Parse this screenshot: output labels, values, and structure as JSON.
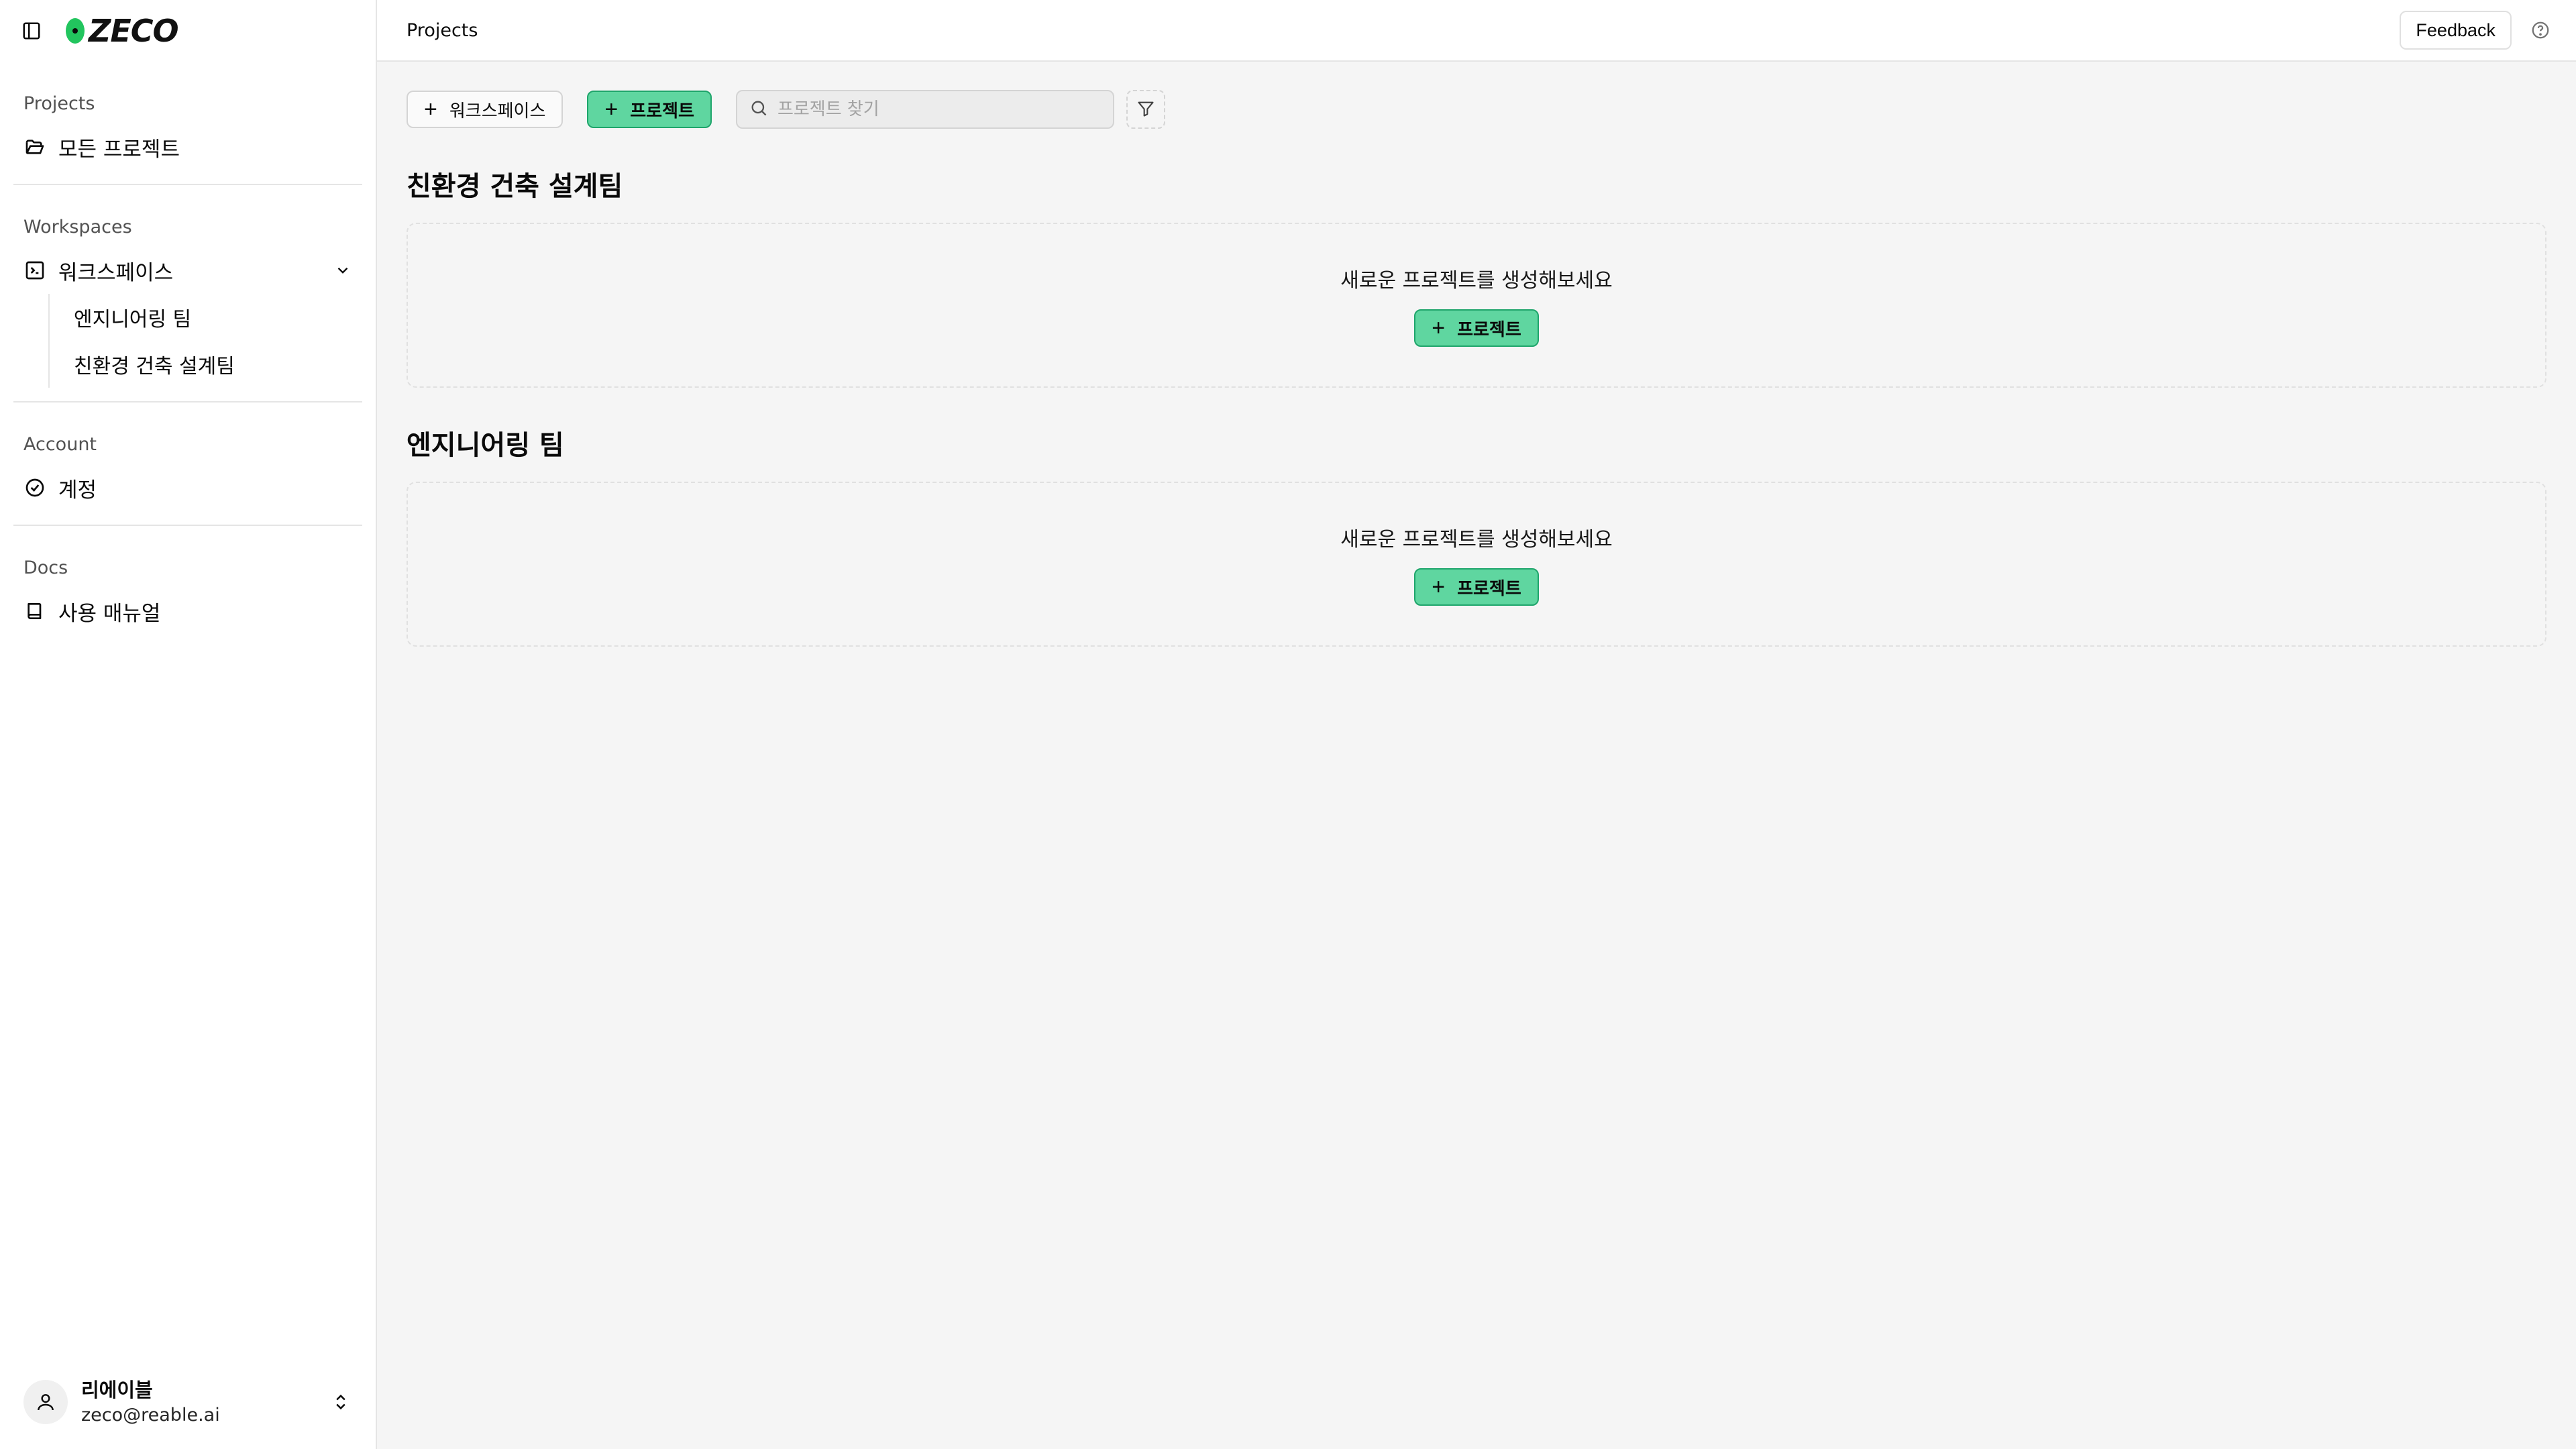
{
  "app": {
    "logo_text": "ZECO",
    "brand_color": "#22c55e"
  },
  "sidebar": {
    "groups": [
      {
        "label": "Projects",
        "items": [
          {
            "label": "모든 프로젝트",
            "icon": "folder-open-icon"
          }
        ]
      },
      {
        "label": "Workspaces",
        "items": [
          {
            "label": "워크스페이스",
            "icon": "workspace-icon"
          }
        ],
        "sub_items": [
          {
            "label": "엔지니어링 팀"
          },
          {
            "label": "친환경 건축 설계팀"
          }
        ]
      },
      {
        "label": "Account",
        "items": [
          {
            "label": "계정",
            "icon": "check-circle-icon"
          }
        ]
      },
      {
        "label": "Docs",
        "items": [
          {
            "label": "사용 매뉴얼",
            "icon": "book-icon"
          }
        ]
      }
    ],
    "user": {
      "name": "리에이블",
      "email": "zeco@reable.ai"
    }
  },
  "topbar": {
    "title": "Projects",
    "feedback_label": "Feedback"
  },
  "toolbar": {
    "add_workspace_label": "워크스페이스",
    "add_project_label": "프로젝트",
    "search_placeholder": "프로젝트 찾기"
  },
  "sections": [
    {
      "title": "친환경 건축 설계팀",
      "empty_text": "새로운 프로젝트를 생성해보세요",
      "button_label": "프로젝트"
    },
    {
      "title": "엔지니어링 팀",
      "empty_text": "새로운 프로젝트를 생성해보세요",
      "button_label": "프로젝트"
    }
  ],
  "colors": {
    "accent_green": "#5fd6a0",
    "accent_green_border": "#1fa56b"
  }
}
